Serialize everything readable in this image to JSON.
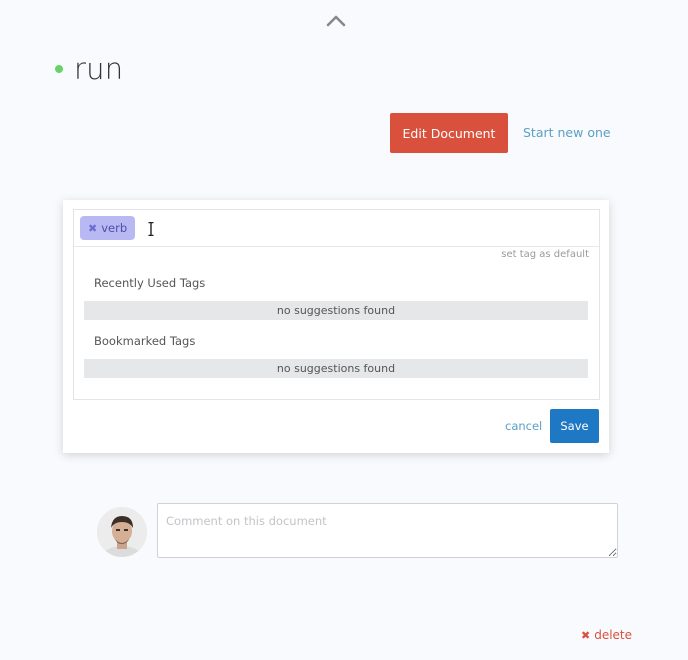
{
  "document": {
    "title": "run",
    "status_color": "#66d36a"
  },
  "actions": {
    "edit_label": "Edit Document",
    "start_new_label": "Start new one"
  },
  "tag_editor": {
    "tags": [
      "verb"
    ],
    "set_default_label": "set tag as default",
    "recent_label": "Recently Used Tags",
    "recent_empty": "no suggestions found",
    "bookmarked_label": "Bookmarked Tags",
    "bookmarked_empty": "no suggestions found",
    "cancel_label": "cancel",
    "save_label": "Save"
  },
  "comment": {
    "placeholder": "Comment on this document"
  },
  "footer": {
    "delete_label": "delete"
  },
  "colors": {
    "edit_button": "#d9513c",
    "save_button": "#1e78c3",
    "tag_chip": "#b8b9f3",
    "link": "#5aa0c4"
  }
}
